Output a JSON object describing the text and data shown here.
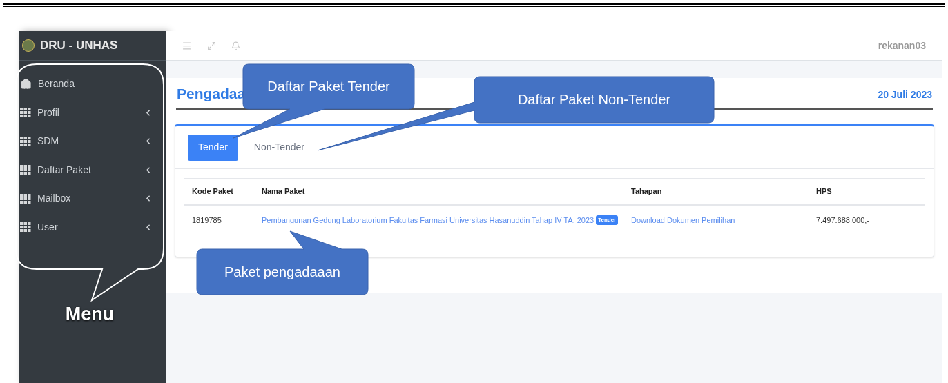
{
  "sidebar": {
    "brand": "DRU - UNHAS",
    "items": [
      {
        "label": "Beranda",
        "kind": "home"
      },
      {
        "label": "Profil",
        "kind": "submenu"
      },
      {
        "label": "SDM",
        "kind": "submenu"
      },
      {
        "label": "Daftar Paket",
        "kind": "submenu"
      },
      {
        "label": "Mailbox",
        "kind": "submenu"
      },
      {
        "label": "User",
        "kind": "submenu"
      }
    ]
  },
  "topbar": {
    "user": "rekanan03"
  },
  "page": {
    "title": "Pengadaa",
    "date": "20 Juli 2023"
  },
  "tabs": [
    {
      "label": "Tender",
      "selected": true
    },
    {
      "label": "Non-Tender",
      "selected": false
    }
  ],
  "table": {
    "columns": [
      "Kode Paket",
      "Nama Paket",
      "Tahapan",
      "HPS"
    ],
    "rows": [
      {
        "kode": "1819785",
        "nama": "Pembangunan Gedung Laboratorium Fakultas Farmasi Universitas Hasanuddin Tahap IV TA. 2023",
        "badge": "Tender",
        "tahapan": "Download Dokumen Pemilihan",
        "hps": "7.497.688.000,-"
      }
    ]
  },
  "callouts": [
    {
      "kind": "filled",
      "text": "Daftar Paket Tender"
    },
    {
      "kind": "filled",
      "text": "Daftar Paket Non-Tender"
    },
    {
      "kind": "filled",
      "text": "Paket pengadaaan"
    },
    {
      "kind": "outline",
      "text": "Menu"
    }
  ]
}
